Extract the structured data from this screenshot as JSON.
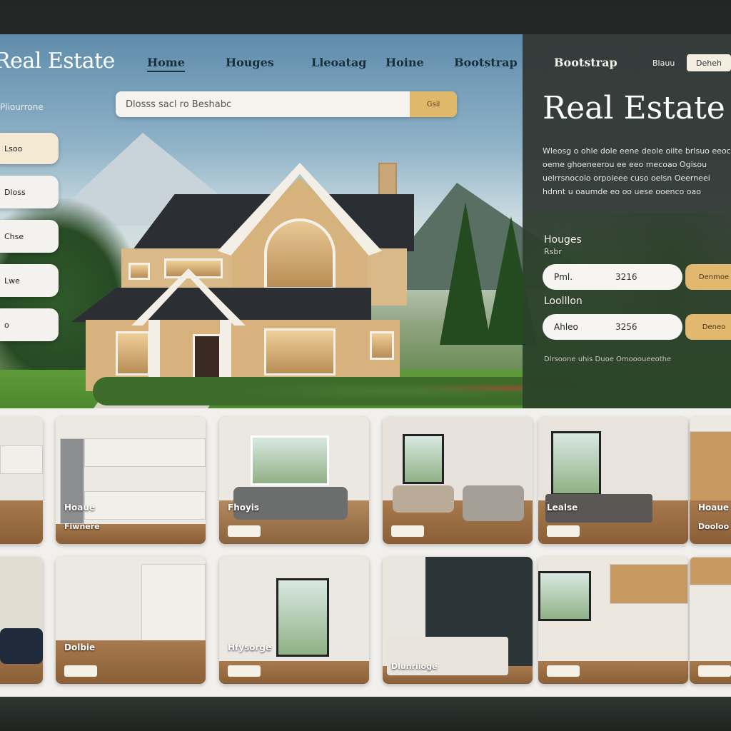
{
  "brand": {
    "logo": "Real Estate"
  },
  "nav": {
    "links": [
      "Home",
      "Houges",
      "Lleoatag",
      "Hoine",
      "Bootstrap"
    ],
    "panel_link": "Bootstrap",
    "small_link": "Blauu",
    "button": "Deheh"
  },
  "search": {
    "placeholder": "Dlosss sacl ro Beshabc",
    "button": "Gsil"
  },
  "breadcrumb": "Pliourrone",
  "filters": [
    "Lsoo",
    "Dloss",
    "Chse",
    "Lwe",
    "o"
  ],
  "panel": {
    "title": "Real Estate",
    "description": "Wleosg o ohle dole eene deole oiite brlsuo eeoc oeme ghoeneerou ee eeo mecoao Ogisou uelrrsnocolo orpoieee cuso oelsn Oeerneei hdnnt u oaumde eo oo uese ooenco oao",
    "houses_label": "Houges",
    "houses_sub": "Rsbr",
    "location_label": "Loolllon",
    "fields": [
      {
        "label": "Pml.",
        "value": "3216",
        "button": "Denmoe"
      },
      {
        "label": "Ahleo",
        "value": "3256",
        "button": "Deneo"
      }
    ],
    "footer": "Dlrsoone uhis Duoe Omoooueeothe"
  },
  "listings": [
    {
      "title": "",
      "sub": "",
      "tag": ""
    },
    {
      "title": "Hoaue",
      "sub": "Fiwnere",
      "tag": ""
    },
    {
      "title": "Fhoyis",
      "sub": "",
      "tag": ""
    },
    {
      "title": "",
      "sub": "",
      "tag": ""
    },
    {
      "title": "Lealse",
      "sub": "",
      "tag": ""
    },
    {
      "title": "Hoaue",
      "sub": "Dooloo",
      "tag": ""
    },
    {
      "title": "",
      "sub": "",
      "tag": ""
    },
    {
      "title": "Dolbie",
      "sub": "",
      "tag": ""
    },
    {
      "title": "",
      "sub": "",
      "tag": ""
    },
    {
      "title": "Hfysorge",
      "sub": "",
      "tag": ""
    },
    {
      "title": "",
      "sub": "Dlunriioge",
      "tag": ""
    },
    {
      "title": "",
      "sub": "",
      "tag": ""
    }
  ],
  "colors": {
    "accent_gold": "#e0b86a",
    "panel_dark": "#343936",
    "text_navy": "#17303d"
  }
}
